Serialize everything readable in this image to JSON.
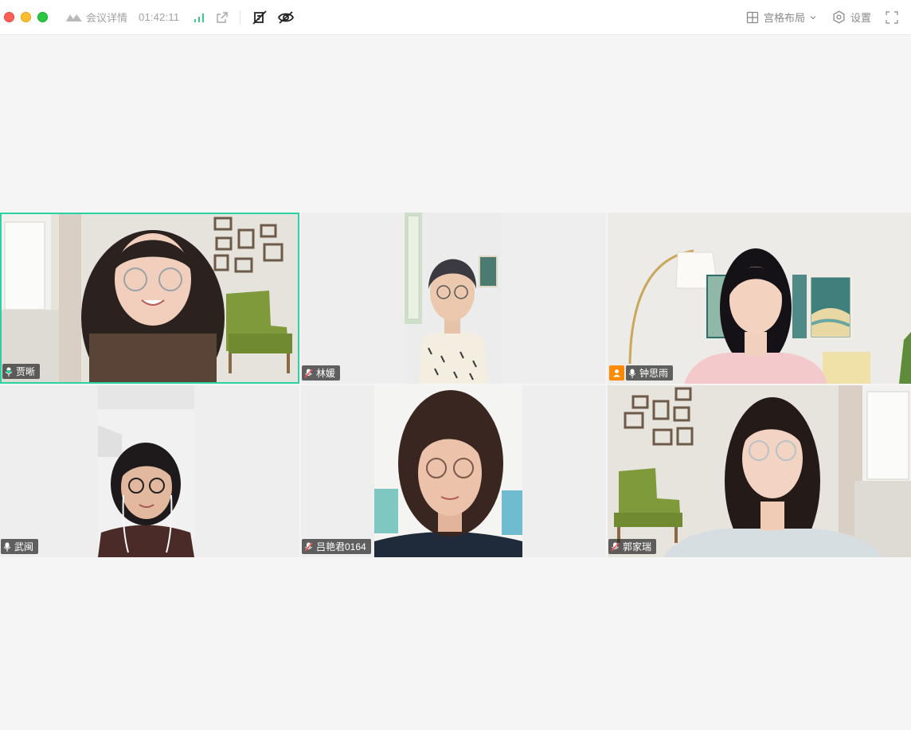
{
  "window": {
    "traffic_lights": {
      "close": "#fe5f57",
      "minimize": "#febc2e",
      "zoom": "#28c840"
    }
  },
  "toolbar": {
    "logo_icon": "meeting-logo-icon",
    "details_label": "会议详情",
    "timer": "01:42:11",
    "signal_icon": "signal-bars-icon",
    "share_icon": "share-external-icon",
    "record_icon": "recording-off-icon",
    "hide_icon": "hide-view-icon",
    "layout_label": "宫格布局",
    "settings_label": "设置",
    "fullscreen_icon": "fullscreen-icon"
  },
  "colors": {
    "active_speaker_border": "#2bd1a0",
    "signal_good": "#39c98a",
    "host_badge": "#ff8a00",
    "background": "#f5f5f5"
  },
  "participants": [
    {
      "name": "贾晰",
      "mic": "speaking",
      "host": false,
      "active": true
    },
    {
      "name": "林媛",
      "mic": "muted",
      "host": false,
      "active": false
    },
    {
      "name": "钟思雨",
      "mic": "on",
      "host": true,
      "active": false
    },
    {
      "name": "武闽",
      "mic": "on",
      "host": false,
      "active": false
    },
    {
      "name": "吕艳君0164",
      "mic": "muted",
      "host": false,
      "active": false
    },
    {
      "name": "郭家瑞",
      "mic": "muted",
      "host": false,
      "active": false
    }
  ]
}
